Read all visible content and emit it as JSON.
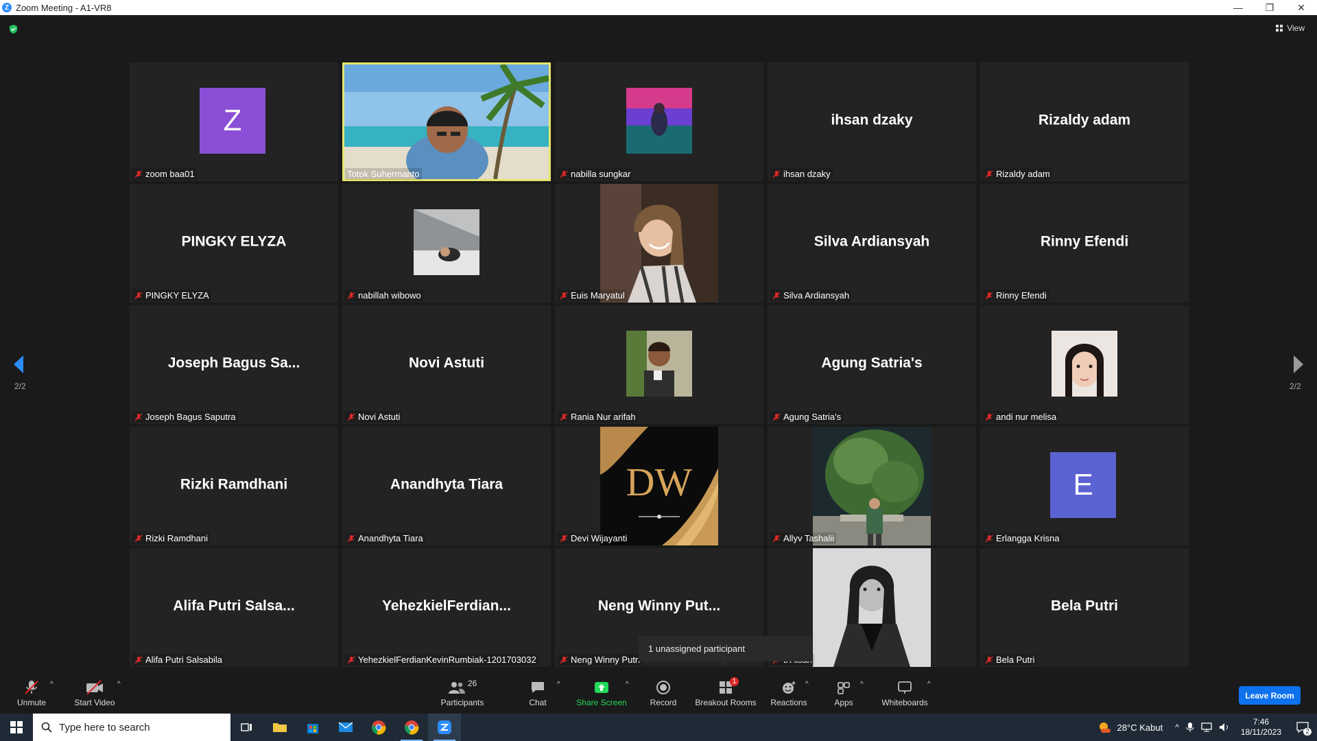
{
  "window": {
    "title": "Zoom Meeting - A1-VR8",
    "minimize": "—",
    "restore": "❐",
    "close": "✕"
  },
  "view_label": "View",
  "pagination": {
    "left": "2/2",
    "right": "2/2"
  },
  "tiles": [
    {
      "label": "zoom baa01",
      "kind": "avatar",
      "letter": "Z",
      "color": "#8a4fd6"
    },
    {
      "label": "Totok Suhermanto",
      "kind": "video",
      "active": true
    },
    {
      "label": "nabilla sungkar",
      "kind": "thumb"
    },
    {
      "label": "ihsan dzaky",
      "kind": "name",
      "display": "ihsan dzaky"
    },
    {
      "label": "Rizaldy adam",
      "kind": "name",
      "display": "Rizaldy adam"
    },
    {
      "label": "PINGKY ELYZA",
      "kind": "name",
      "display": "PINGKY ELYZA"
    },
    {
      "label": "nabillah wibowo",
      "kind": "thumb"
    },
    {
      "label": "Euis Maryatul",
      "kind": "tall"
    },
    {
      "label": "Silva Ardiansyah",
      "kind": "name",
      "display": "Silva Ardiansyah"
    },
    {
      "label": "Rinny Efendi",
      "kind": "name",
      "display": "Rinny Efendi"
    },
    {
      "label": "Joseph Bagus Saputra",
      "kind": "name",
      "display": "Joseph Bagus Sa..."
    },
    {
      "label": "Novi Astuti",
      "kind": "name",
      "display": "Novi Astuti"
    },
    {
      "label": "Rania Nur arifah",
      "kind": "thumb"
    },
    {
      "label": "Agung Satria's",
      "kind": "name",
      "display": "Agung Satria's"
    },
    {
      "label": "andi nur melisa",
      "kind": "thumb"
    },
    {
      "label": "Rizki Ramdhani",
      "kind": "name",
      "display": "Rizki Ramdhani"
    },
    {
      "label": "Anandhyta Tiara",
      "kind": "name",
      "display": "Anandhyta Tiara"
    },
    {
      "label": "Devi Wijayanti",
      "kind": "tall",
      "logo": "DW"
    },
    {
      "label": "Allyv Tashalii",
      "kind": "tall"
    },
    {
      "label": "Erlangga Krisna",
      "kind": "avatar",
      "letter": "E",
      "color": "#5b63d3"
    },
    {
      "label": "Alifa Putri Salsabila",
      "kind": "name",
      "display": "Alifa Putri Salsa..."
    },
    {
      "label": "YehezkielFerdianKevinRumbiak-1201703032",
      "kind": "name",
      "display": "YehezkielFerdian..."
    },
    {
      "label": "Neng Winny Putri",
      "kind": "name",
      "display": "Neng Winny Put..."
    },
    {
      "label": "ti Aisah",
      "kind": "tall"
    },
    {
      "label": "Bela Putri",
      "kind": "name",
      "display": "Bela Putri"
    }
  ],
  "tooltip": "1 unassigned participant",
  "toolbar": {
    "unmute": "Unmute",
    "start_video": "Start Video",
    "participants": "Participants",
    "participants_count": "26",
    "chat": "Chat",
    "share_screen": "Share Screen",
    "record": "Record",
    "breakout_rooms": "Breakout Rooms",
    "breakout_badge": "1",
    "reactions": "Reactions",
    "apps": "Apps",
    "whiteboards": "Whiteboards",
    "leave_room": "Leave Room"
  },
  "taskbar": {
    "search_placeholder": "Type here to search",
    "weather": "28°C  Kabut",
    "time": "7:46",
    "date": "18/11/2023",
    "notifications": "2"
  },
  "colors": {
    "accent": "#0e72ed",
    "share": "#23d959",
    "active_border": "#e6e56a",
    "muted": "#e02828"
  }
}
